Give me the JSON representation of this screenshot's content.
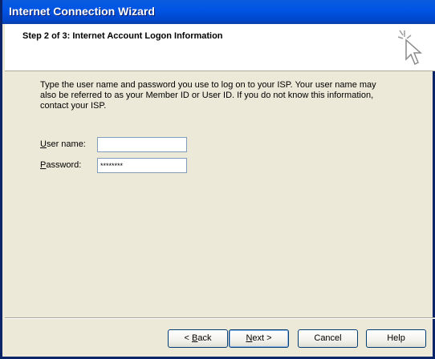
{
  "window": {
    "title": "Internet Connection Wizard"
  },
  "header": {
    "step_title": "Step 2 of 3: Internet Account Logon Information",
    "icon": "wizard-sparkle-cursor-icon"
  },
  "instructions": "Type the user name and password you use to log on to your ISP. Your user name may also be referred to as your Member ID or User ID. If you do not know this information, contact your ISP.",
  "fields": {
    "username": {
      "label_key": "U",
      "label_rest": "ser name:",
      "value": ""
    },
    "password": {
      "label_key": "P",
      "label_rest": "assword:",
      "value": "********"
    }
  },
  "buttons": {
    "back": {
      "prefix": "< ",
      "key": "B",
      "rest": "ack"
    },
    "next": {
      "key": "N",
      "rest": "ext >"
    },
    "cancel": "Cancel",
    "help": "Help"
  }
}
